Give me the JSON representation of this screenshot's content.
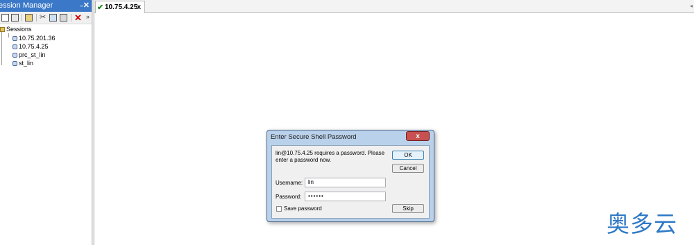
{
  "session_manager": {
    "title": "ession Manager",
    "pin_glyph": "▫",
    "close_glyph": "✕",
    "toolbar_more": "»",
    "tree": {
      "root": "Sessions",
      "items": [
        "10.75.201.36",
        "10.75.4.25",
        "prc_st_lin",
        "st_lin"
      ]
    }
  },
  "tabs": [
    {
      "label": "10.75.4.25",
      "close": "x"
    }
  ],
  "dialog": {
    "title": "Enter Secure Shell Password",
    "close": "x",
    "message": "lin@10.75.4.25 requires a password.  Please\nenter a password now.",
    "ok": "OK",
    "cancel": "Cancel",
    "skip": "Skip",
    "username_label": "Username:",
    "username_value": "lin",
    "password_label": "Password:",
    "password_value": "••••••",
    "save_password_label": "Save password"
  },
  "watermark": "奥多云",
  "colors": {
    "titlebar": "#3b78c8",
    "dialog_frame": "#b9d1ea",
    "close_button": "#c75050",
    "watermark": "#2e79c6"
  }
}
